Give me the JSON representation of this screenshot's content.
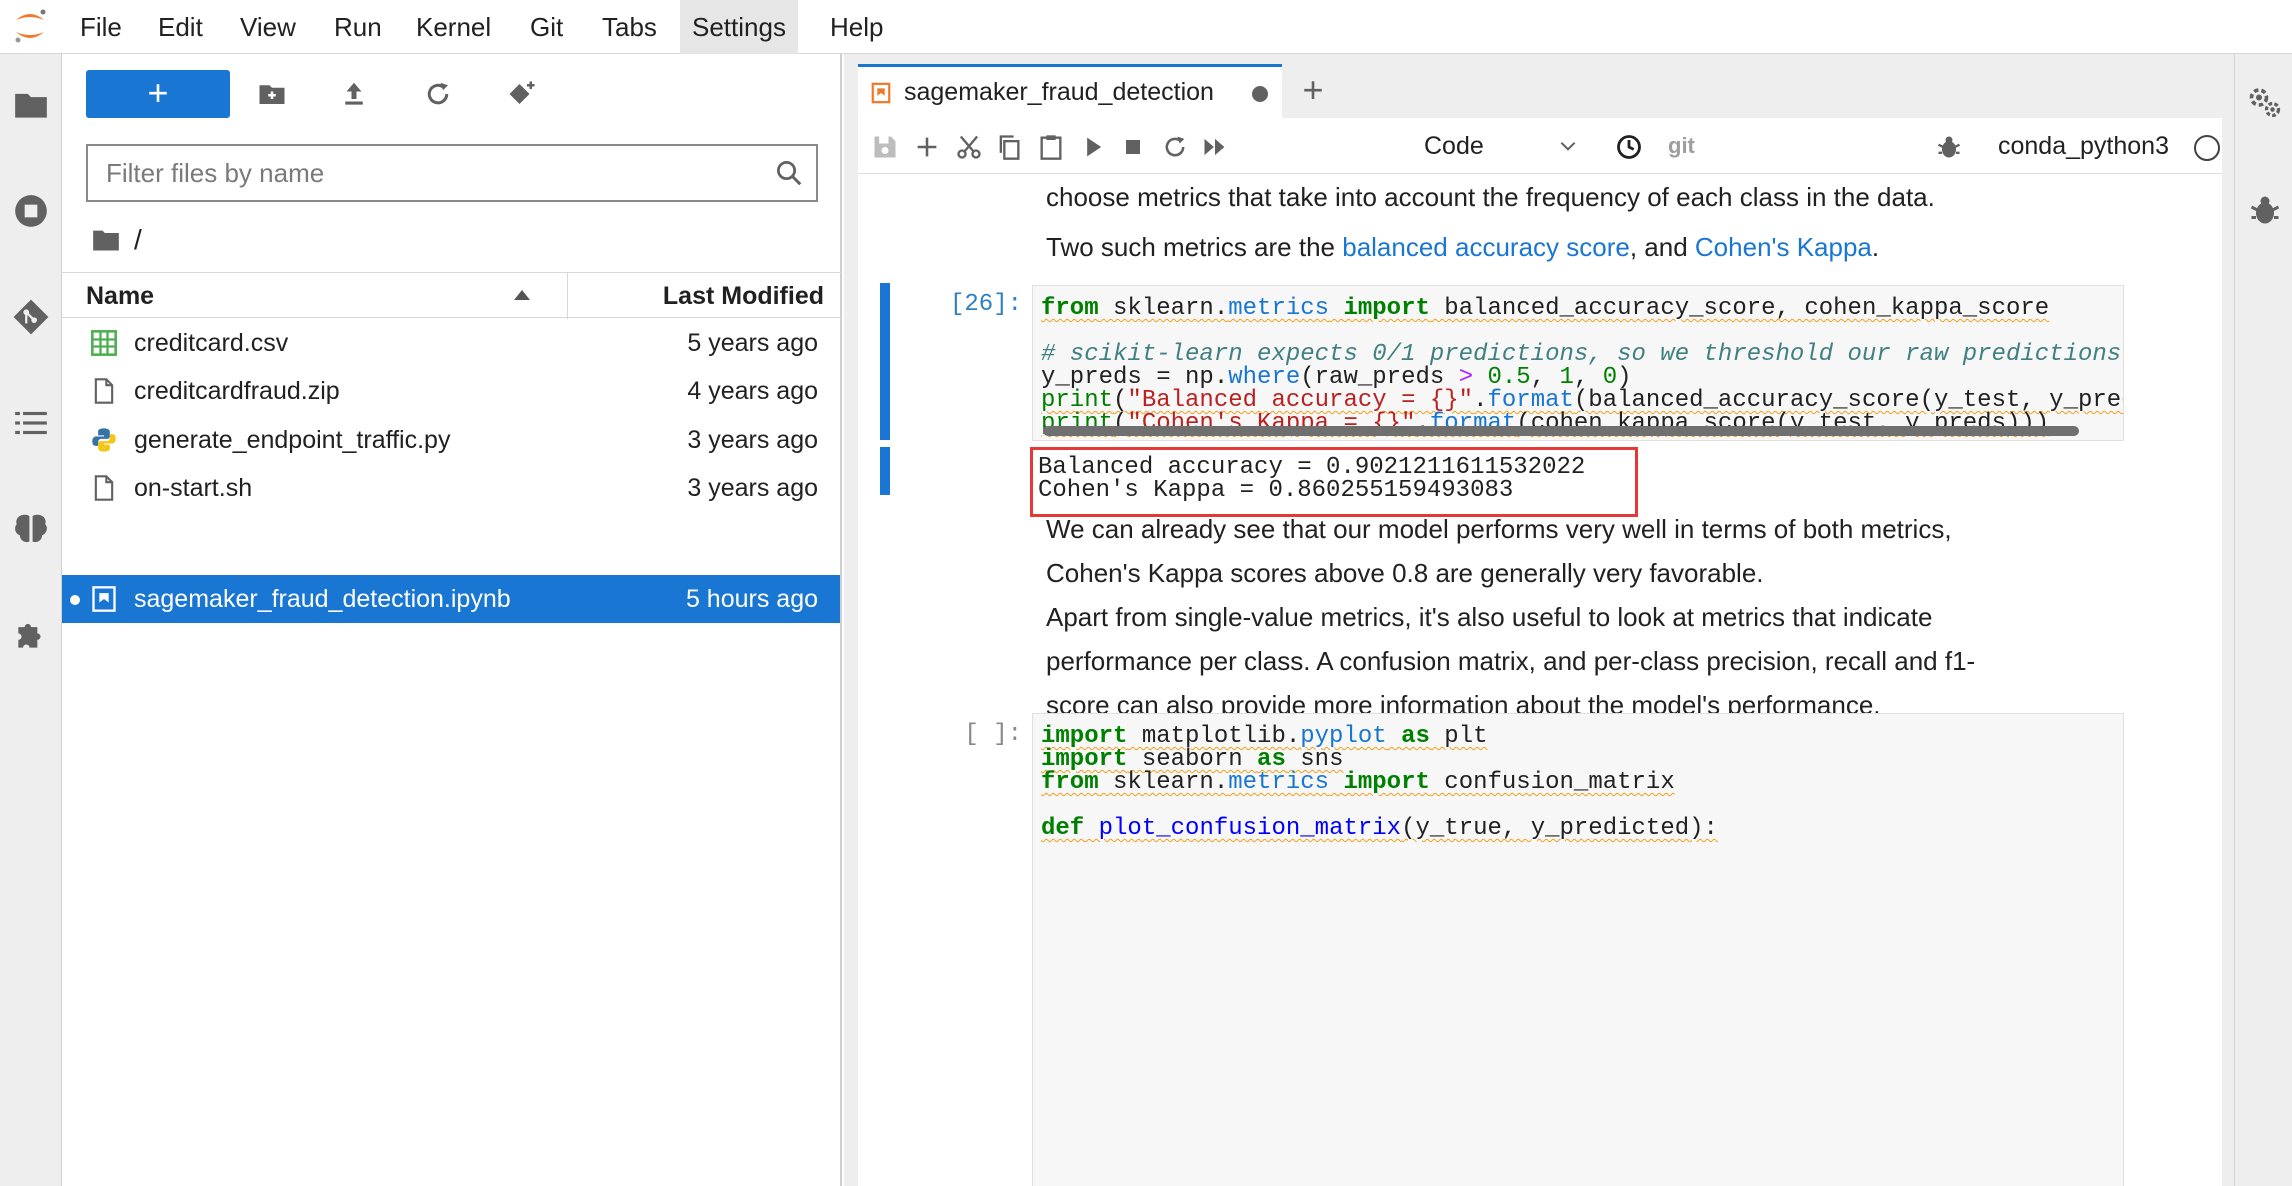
{
  "menu": [
    "File",
    "Edit",
    "View",
    "Run",
    "Kernel",
    "Git",
    "Tabs",
    "Settings",
    "Help"
  ],
  "file_browser": {
    "new_label": "+",
    "filter_placeholder": "Filter files by name",
    "path": "/",
    "columns": {
      "name": "Name",
      "modified": "Last Modified"
    },
    "files": [
      {
        "name": "creditcard.csv",
        "modified": "5 years ago",
        "icon": "spreadsheet-icon"
      },
      {
        "name": "creditcardfraud.zip",
        "modified": "4 years ago",
        "icon": "file-icon"
      },
      {
        "name": "generate_endpoint_traffic.py",
        "modified": "3 years ago",
        "icon": "python-icon"
      },
      {
        "name": "on-start.sh",
        "modified": "3 years ago",
        "icon": "file-icon"
      },
      {
        "name": "sagemaker_fraud_detection.ipynb",
        "modified": "5 hours ago",
        "icon": "notebook-icon",
        "selected": true
      }
    ]
  },
  "tab": {
    "label": "sagemaker_fraud_detection",
    "add_label": "+"
  },
  "notebook_toolbar": {
    "cell_type": "Code",
    "git": "git",
    "kernel": "conda_python3"
  },
  "cells": {
    "md1_line1": "choose metrics that take into account the frequency of each class in the data.",
    "md2_prefix": "Two such metrics are the ",
    "md2_link1": "balanced accuracy score",
    "md2_mid": ", and ",
    "md2_link2": "Cohen's Kappa",
    "md2_suffix": ".",
    "prompt_26": "[26]:",
    "output_lines": [
      "Balanced accuracy = 0.9021211611532022",
      "Cohen's Kappa = 0.860255159493083"
    ],
    "md3_lines": [
      "We can already see that our model performs very well in terms of both metrics,",
      "Cohen's Kappa scores above 0.8 are generally very favorable."
    ],
    "md4_lines": [
      "Apart from single-value metrics, it's also useful to look at metrics that indicate",
      "performance per class. A confusion matrix, and per-class precision, recall and f1-",
      "score can also provide more information about the model's performance."
    ],
    "prompt_next": "[ ]:"
  }
}
